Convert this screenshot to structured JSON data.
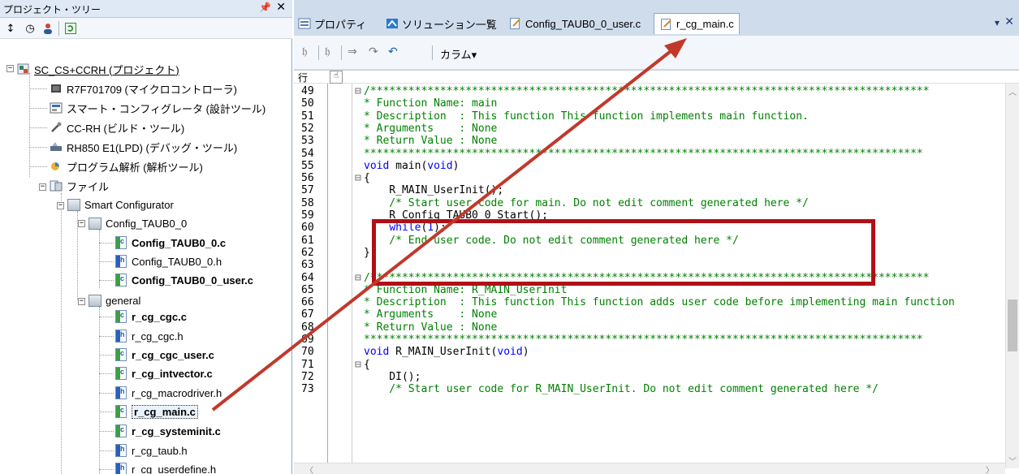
{
  "project_tree": {
    "title": "プロジェクト・ツリー",
    "pin_glyph": "ᵽ",
    "close_glyph": "✕",
    "items": [
      {
        "label": "SC_CS+CCRH (プロジェクト)",
        "icon": "project-icon"
      },
      {
        "label": "R7F701709 (マイクロコントローラ)",
        "icon": "microcontroller-icon"
      },
      {
        "label": "スマート・コンフィグレータ (設計ツール)",
        "icon": "configurator-icon"
      },
      {
        "label": "CC-RH (ビルド・ツール)",
        "icon": "build-tool-icon"
      },
      {
        "label": "RH850 E1(LPD) (デバッグ・ツール)",
        "icon": "debug-tool-icon"
      },
      {
        "label": "プログラム解析 (解析ツール)",
        "icon": "analysis-tool-icon"
      },
      {
        "label": "ファイル",
        "icon": "folder-icon"
      },
      {
        "label": "Smart Configurator",
        "icon": "folder-icon"
      },
      {
        "label": "Config_TAUB0_0",
        "icon": "folder-icon"
      },
      {
        "label": "Config_TAUB0_0.c",
        "icon": "c-file-icon"
      },
      {
        "label": "Config_TAUB0_0.h",
        "icon": "h-file-icon"
      },
      {
        "label": "Config_TAUB0_0_user.c",
        "icon": "c-file-icon"
      },
      {
        "label": "general",
        "icon": "folder-icon"
      },
      {
        "label": "r_cg_cgc.c",
        "icon": "c-file-icon"
      },
      {
        "label": "r_cg_cgc.h",
        "icon": "h-file-icon"
      },
      {
        "label": "r_cg_cgc_user.c",
        "icon": "c-file-icon"
      },
      {
        "label": "r_cg_intvector.c",
        "icon": "c-file-icon"
      },
      {
        "label": "r_cg_macrodriver.h",
        "icon": "h-file-icon"
      },
      {
        "label": "r_cg_main.c",
        "icon": "c-file-icon"
      },
      {
        "label": "r_cg_systeminit.c",
        "icon": "c-file-icon"
      },
      {
        "label": "r_cg_taub.h",
        "icon": "h-file-icon"
      },
      {
        "label": "r_cg_userdefine.h",
        "icon": "h-file-icon"
      }
    ]
  },
  "tabs": [
    {
      "label": "プロパティ",
      "icon": "properties-icon"
    },
    {
      "label": "ソリューション一覧",
      "icon": "solution-icon"
    },
    {
      "label": "Config_TAUB0_0_user.c",
      "icon": "c-file-icon"
    },
    {
      "label": "r_cg_main.c",
      "icon": "c-file-icon"
    }
  ],
  "tab_controls": {
    "menu_glyph": "▾",
    "close_glyph": "✕"
  },
  "editor_toolbar": {
    "column_label": "カラム▾"
  },
  "editor": {
    "line_header": "行",
    "lines": [
      {
        "n": "49",
        "fold": "⊟",
        "text": "/****************************************************************************************"
      },
      {
        "n": "50",
        "fold": "",
        "text": "* Function Name: main"
      },
      {
        "n": "51",
        "fold": "",
        "text": "* Description  : This function This function implements main function."
      },
      {
        "n": "52",
        "fold": "",
        "text": "* Arguments    : None"
      },
      {
        "n": "53",
        "fold": "",
        "text": "* Return Value : None"
      },
      {
        "n": "54",
        "fold": "",
        "text": "****************************************************************************************"
      },
      {
        "n": "55",
        "fold": "",
        "text": "void main(void)"
      },
      {
        "n": "56",
        "fold": "⊟",
        "text": "{"
      },
      {
        "n": "57",
        "fold": "",
        "text": "    R_MAIN_UserInit();"
      },
      {
        "n": "58",
        "fold": "",
        "text": "    /* Start user code for main. Do not edit comment generated here */"
      },
      {
        "n": "59",
        "fold": "",
        "text": "    R_Config_TAUB0_0_Start();"
      },
      {
        "n": "60",
        "fold": "",
        "text": "    while(1);"
      },
      {
        "n": "61",
        "fold": "",
        "text": "    /* End user code. Do not edit comment generated here */"
      },
      {
        "n": "62",
        "fold": "",
        "text": "}"
      },
      {
        "n": "63",
        "fold": "",
        "text": ""
      },
      {
        "n": "64",
        "fold": "⊟",
        "text": "/****************************************************************************************"
      },
      {
        "n": "65",
        "fold": "",
        "text": "* Function Name: R_MAIN_UserInit"
      },
      {
        "n": "66",
        "fold": "",
        "text": "* Description  : This function This function adds user code before implementing main function"
      },
      {
        "n": "67",
        "fold": "",
        "text": "* Arguments    : None"
      },
      {
        "n": "68",
        "fold": "",
        "text": "* Return Value : None"
      },
      {
        "n": "69",
        "fold": "",
        "text": "****************************************************************************************"
      },
      {
        "n": "70",
        "fold": "",
        "text": "void R_MAIN_UserInit(void)"
      },
      {
        "n": "71",
        "fold": "⊟",
        "text": "{"
      },
      {
        "n": "72",
        "fold": "",
        "text": "    DI();"
      },
      {
        "n": "73",
        "fold": "",
        "text": "    /* Start user code for R_MAIN_UserInit. Do not edit comment generated here */"
      }
    ]
  },
  "colors": {
    "annotation": "#b01016",
    "comment": "#008000",
    "keyword": "#0000ff"
  }
}
